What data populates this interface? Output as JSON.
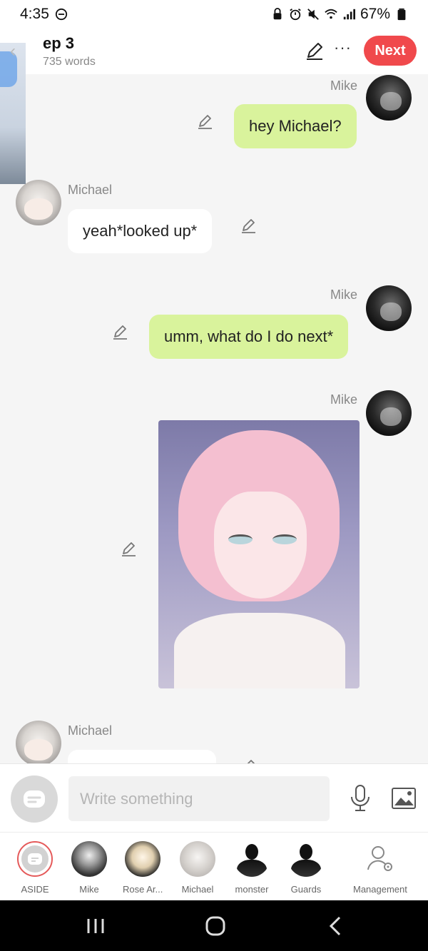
{
  "status_bar": {
    "time": "4:35",
    "battery": "67%"
  },
  "header": {
    "episode_title": "ep 3",
    "word_count": "735 words",
    "more_label": "···",
    "next_label": "Next"
  },
  "messages": [
    {
      "speaker": "Mike",
      "side": "right",
      "type": "text",
      "text": "hey Michael?"
    },
    {
      "speaker": "Michael",
      "side": "left",
      "type": "text",
      "text": "yeah*looked up*"
    },
    {
      "speaker": "Mike",
      "side": "right",
      "type": "text",
      "text": "umm, what do I do next*"
    },
    {
      "speaker": "Mike",
      "side": "right",
      "type": "image",
      "text": ""
    },
    {
      "speaker": "Michael",
      "side": "left",
      "type": "text",
      "text": ""
    }
  ],
  "composer": {
    "placeholder": "Write something"
  },
  "characters": [
    {
      "label": "ASIDE"
    },
    {
      "label": "Mike"
    },
    {
      "label": "Rose Ar..."
    },
    {
      "label": "Michael"
    },
    {
      "label": "monster"
    },
    {
      "label": "Guards"
    },
    {
      "label": "Management"
    }
  ],
  "colors": {
    "accent": "#f0494c",
    "right_bubble": "#d9f39c",
    "left_bubble": "#ffffff",
    "background": "#f5f5f5"
  }
}
